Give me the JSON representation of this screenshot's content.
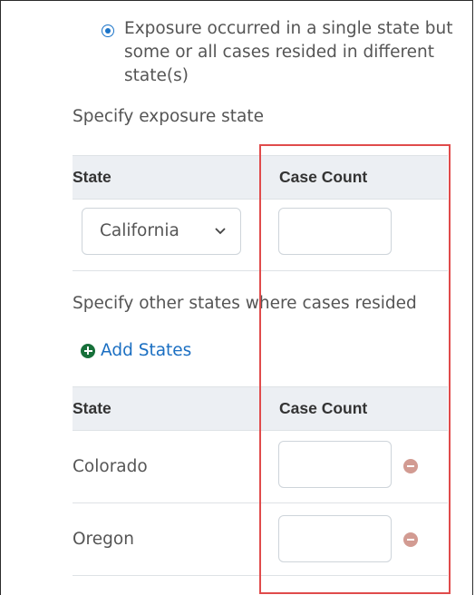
{
  "exposure": {
    "option_label": "Exposure occurred in a single state but some or all cases resided in different state(s)",
    "option_selected": true
  },
  "exposure_state": {
    "section_label": "Specify exposure state",
    "headers": {
      "state": "State",
      "case_count": "Case Count"
    },
    "selected_state": "California",
    "case_count_value": ""
  },
  "other_states": {
    "section_label": "Specify other states where cases resided",
    "add_label": "Add States",
    "headers": {
      "state": "State",
      "case_count": "Case Count"
    },
    "rows": [
      {
        "state": "Colorado",
        "case_count": ""
      },
      {
        "state": "Oregon",
        "case_count": ""
      }
    ]
  },
  "colors": {
    "accent": "#1a73c8",
    "highlight": "#e04b4b",
    "add_icon": "#17703a",
    "remove_icon": "#d29b92",
    "header_bg": "#eceff3"
  },
  "icons": {
    "radio": "radio-selected-icon",
    "chevron": "chevron-down-icon",
    "add": "plus-circle-icon",
    "remove": "minus-circle-icon"
  }
}
